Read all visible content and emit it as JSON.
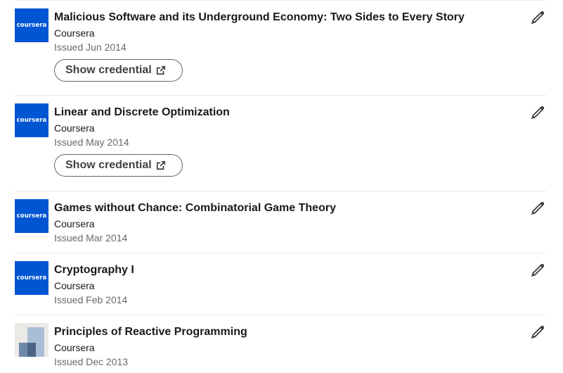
{
  "certifications": [
    {
      "title": "Malicious Software and its Underground Economy: Two Sides to Every Story",
      "issuer": "Coursera",
      "issued": "Issued Jun 2014",
      "logo": "coursera",
      "logo_text": "coursera",
      "credential_label": "Show credential"
    },
    {
      "title": "Linear and Discrete Optimization",
      "issuer": "Coursera",
      "issued": "Issued May 2014",
      "logo": "coursera",
      "logo_text": "coursera",
      "credential_label": "Show credential"
    },
    {
      "title": "Games without Chance: Combinatorial Game Theory",
      "issuer": "Coursera",
      "issued": "Issued Mar 2014",
      "logo": "coursera",
      "logo_text": "coursera"
    },
    {
      "title": "Cryptography I",
      "issuer": "Coursera",
      "issued": "Issued Feb 2014",
      "logo": "coursera",
      "logo_text": "coursera"
    },
    {
      "title": "Principles of Reactive Programming",
      "issuer": "Coursera",
      "issued": "Issued Dec 2013",
      "logo": "abstract-blocks"
    }
  ],
  "icons": {
    "edit": "pencil-icon",
    "external": "external-link-icon"
  },
  "colors": {
    "coursera_blue": "#0056d2",
    "divider": "#e8e8e8"
  }
}
